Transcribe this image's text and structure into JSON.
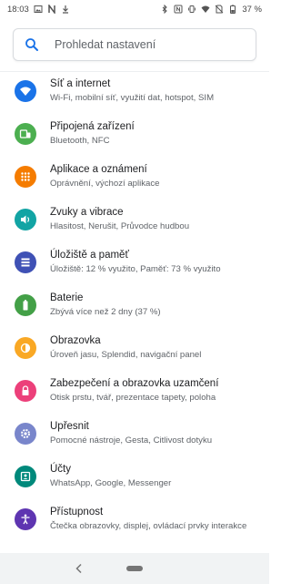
{
  "status_bar": {
    "time": "18:03",
    "battery_percent": "37 %",
    "left_icons": [
      "gallery-icon",
      "n-icon",
      "download-icon"
    ],
    "right_icons": [
      "bluetooth-icon",
      "nfc-icon",
      "vibrate-icon",
      "wifi-icon",
      "no-sim-icon",
      "battery-icon"
    ]
  },
  "search": {
    "placeholder": "Prohledat nastavení"
  },
  "settings_items": [
    {
      "title": "Síť a internet",
      "subtitle": "Wi-Fi, mobilní síť, využití dat, hotspot, SIM",
      "icon": "wifi-icon",
      "color": "#1a73e8"
    },
    {
      "title": "Připojená zařízení",
      "subtitle": "Bluetooth, NFC",
      "icon": "devices-icon",
      "color": "#4caf50"
    },
    {
      "title": "Aplikace a oznámení",
      "subtitle": "Oprávnění, výchozí aplikace",
      "icon": "apps-icon",
      "color": "#f57c00"
    },
    {
      "title": "Zvuky a vibrace",
      "subtitle": "Hlasitost, Nerušit, Průvodce hudbou",
      "icon": "volume-icon",
      "color": "#12a4a4"
    },
    {
      "title": "Úložiště a paměť",
      "subtitle": "Úložiště: 12 % využito, Paměť: 73 % využito",
      "icon": "storage-icon",
      "color": "#3f51b5"
    },
    {
      "title": "Baterie",
      "subtitle": "Zbývá více než 2 dny (37 %)",
      "icon": "battery-icon",
      "color": "#43a047"
    },
    {
      "title": "Obrazovka",
      "subtitle": "Úroveň jasu, Splendid, navigační panel",
      "icon": "brightness-icon",
      "color": "#f9a825"
    },
    {
      "title": "Zabezpečení a obrazovka uzamčení",
      "subtitle": "Otisk prstu, tvář, prezentace tapety, poloha",
      "icon": "lock-icon",
      "color": "#ec407a"
    },
    {
      "title": "Upřesnit",
      "subtitle": "Pomocné nástroje, Gesta, Citlivost dotyku",
      "icon": "gear-icon",
      "color": "#7986cb"
    },
    {
      "title": "Účty",
      "subtitle": "WhatsApp, Google, Messenger",
      "icon": "account-icon",
      "color": "#00897b"
    },
    {
      "title": "Přístupnost",
      "subtitle": "Čtečka obrazovky, displej, ovládací prvky interakce",
      "icon": "accessibility-icon",
      "color": "#5e35b1"
    }
  ],
  "nav_bar": {
    "buttons": [
      "back-icon",
      "home-pill"
    ]
  }
}
